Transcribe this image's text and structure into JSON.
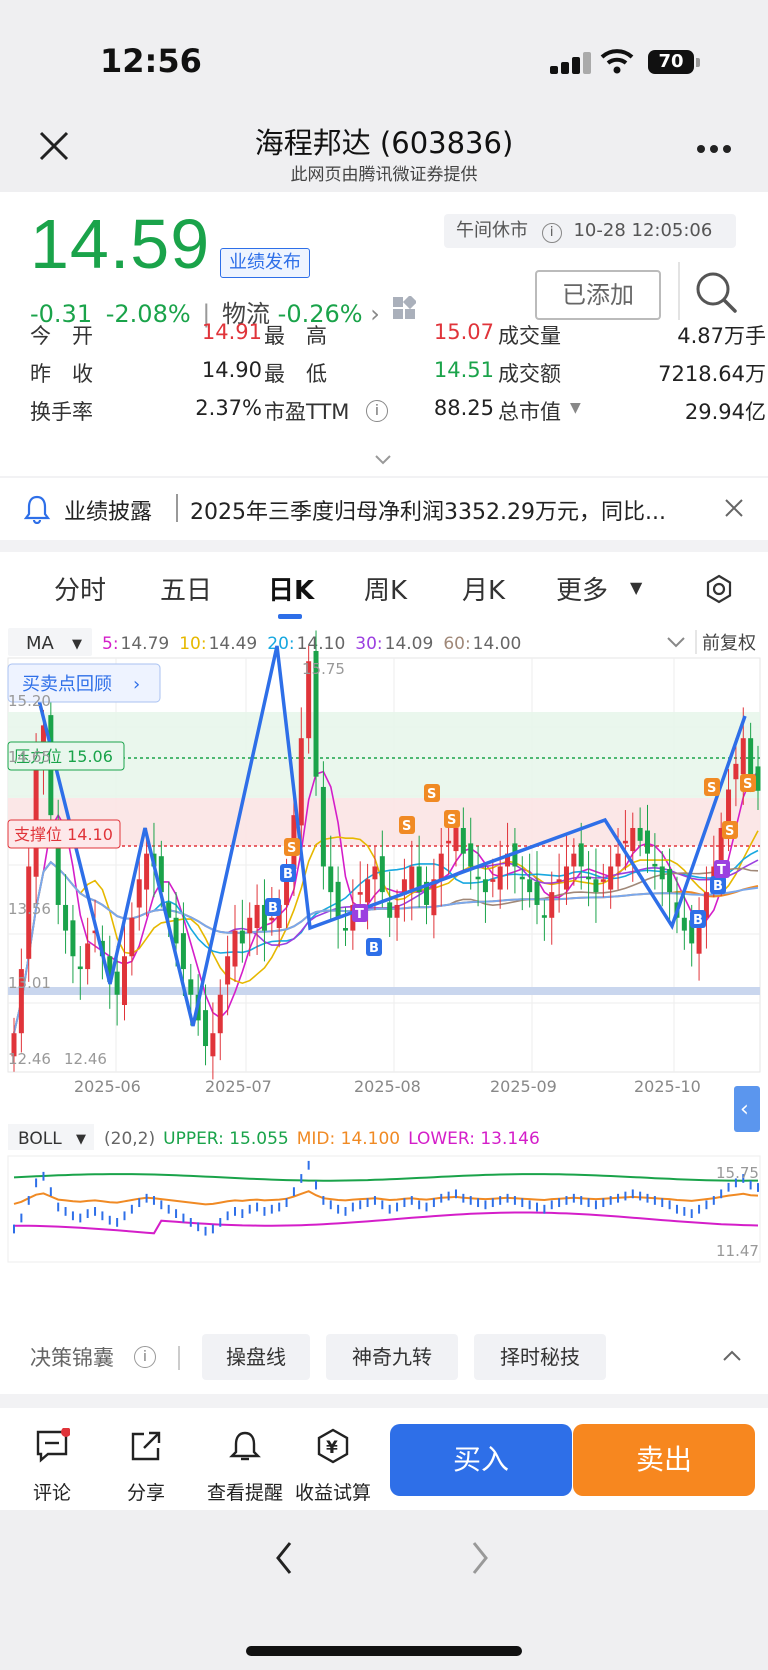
{
  "status": {
    "time": "12:56",
    "battery": "70"
  },
  "header": {
    "title": "海程邦达 (603836)",
    "subtitle": "此网页由腾讯微证券提供"
  },
  "quote": {
    "price": "14.59",
    "earnings_badge": "业绩发布",
    "change": "-0.31",
    "change_pct": "-2.08%",
    "sector_name": "物流",
    "sector_change": "-0.26%",
    "market_status": "午间休市",
    "timestamp": "10-28 12:05:06",
    "added_label": "已添加",
    "stats": [
      {
        "label": "今　开",
        "value": "14.91",
        "color": "#e0343a"
      },
      {
        "label": "最　高",
        "value": "15.07",
        "color": "#e0343a"
      },
      {
        "label": "成交量",
        "value": "4.87万手",
        "color": "#222222"
      },
      {
        "label": "昨　收",
        "value": "14.90",
        "color": "#222222"
      },
      {
        "label": "最　低",
        "value": "14.51",
        "color": "#1aa34a"
      },
      {
        "label": "成交额",
        "value": "7218.64万",
        "color": "#222222"
      },
      {
        "label": "换手率",
        "value": "2.37%",
        "color": "#222222"
      },
      {
        "label": "市盈TTM",
        "value": "88.25",
        "color": "#222222"
      },
      {
        "label": "总市值",
        "value": "29.94亿",
        "color": "#222222"
      }
    ]
  },
  "news": {
    "label": "业绩披露",
    "text": "2025年三季度归母净利润3352.29万元，同比..."
  },
  "tabs": [
    "分时",
    "五日",
    "日K",
    "周K",
    "月K",
    "更多"
  ],
  "active_tab": "日K",
  "indicator": {
    "ma_label": "MA",
    "ma_values": [
      {
        "label": "5:",
        "value": "14.79",
        "color": "#d41ec9"
      },
      {
        "label": "10:",
        "value": "14.49",
        "color": "#e6b800"
      },
      {
        "label": "20:",
        "value": "14.10",
        "color": "#18a8e0"
      },
      {
        "label": "30:",
        "value": "14.09",
        "color": "#9b40e0"
      },
      {
        "label": "60:",
        "value": "14.00",
        "color": "#a08878"
      }
    ],
    "adjust": "前复权",
    "review_btn": "买卖点回顾",
    "resistance": "压力位 15.06",
    "support": "支撑位 14.10"
  },
  "chart_data": {
    "type": "candlestick",
    "x_ticks": [
      "2025-06",
      "2025-07",
      "2025-08",
      "2025-09",
      "2025-10"
    ],
    "y_ticks": [
      "15.20",
      "14.65",
      "13.56",
      "13.01",
      "12.46"
    ],
    "high_label": "15.75",
    "low_label": "12.46",
    "ylim": [
      12.46,
      15.75
    ],
    "resistance": 15.06,
    "support": 14.1,
    "closes": [
      12.7,
      13.2,
      14.0,
      14.8,
      15.1,
      14.4,
      13.7,
      13.5,
      13.3,
      13.2,
      13.4,
      13.5,
      13.3,
      13.1,
      13.0,
      13.3,
      13.6,
      13.9,
      14.1,
      14.0,
      13.8,
      13.6,
      13.4,
      13.2,
      13.0,
      12.8,
      12.6,
      12.7,
      13.0,
      13.3,
      13.5,
      13.4,
      13.6,
      13.7,
      13.5,
      13.6,
      13.7,
      13.9,
      14.4,
      15.0,
      15.6,
      14.7,
      14.0,
      13.8,
      13.6,
      13.5,
      13.7,
      13.8,
      13.9,
      14.0,
      13.8,
      13.6,
      13.7,
      13.9,
      14.0,
      13.8,
      13.7,
      13.9,
      14.1,
      14.2,
      14.3,
      14.1,
      14.0,
      13.9,
      13.8,
      13.9,
      14.0,
      14.1,
      14.0,
      13.9,
      13.8,
      13.7,
      13.6,
      13.8,
      13.9,
      14.0,
      14.1,
      14.0,
      13.9,
      13.8,
      13.9,
      14.0,
      14.1,
      14.2,
      14.3,
      14.2,
      14.1,
      14.0,
      13.9,
      13.8,
      13.6,
      13.5,
      13.4,
      13.6,
      13.8,
      14.0,
      14.3,
      14.6,
      14.8,
      15.0,
      14.7,
      14.59
    ],
    "boll": {
      "params": "(20,2)",
      "upper": "15.055",
      "mid": "14.100",
      "lower": "13.146",
      "max_label": "15.75",
      "min_label": "11.47"
    }
  },
  "boll_label": "BOLL",
  "decision": {
    "title": "决策锦囊",
    "pills": [
      "操盘线",
      "神奇九转",
      "择时秘技"
    ]
  },
  "bottom": {
    "items": [
      "评论",
      "分享",
      "查看提醒",
      "收益试算"
    ],
    "buy": "买入",
    "sell": "卖出"
  }
}
